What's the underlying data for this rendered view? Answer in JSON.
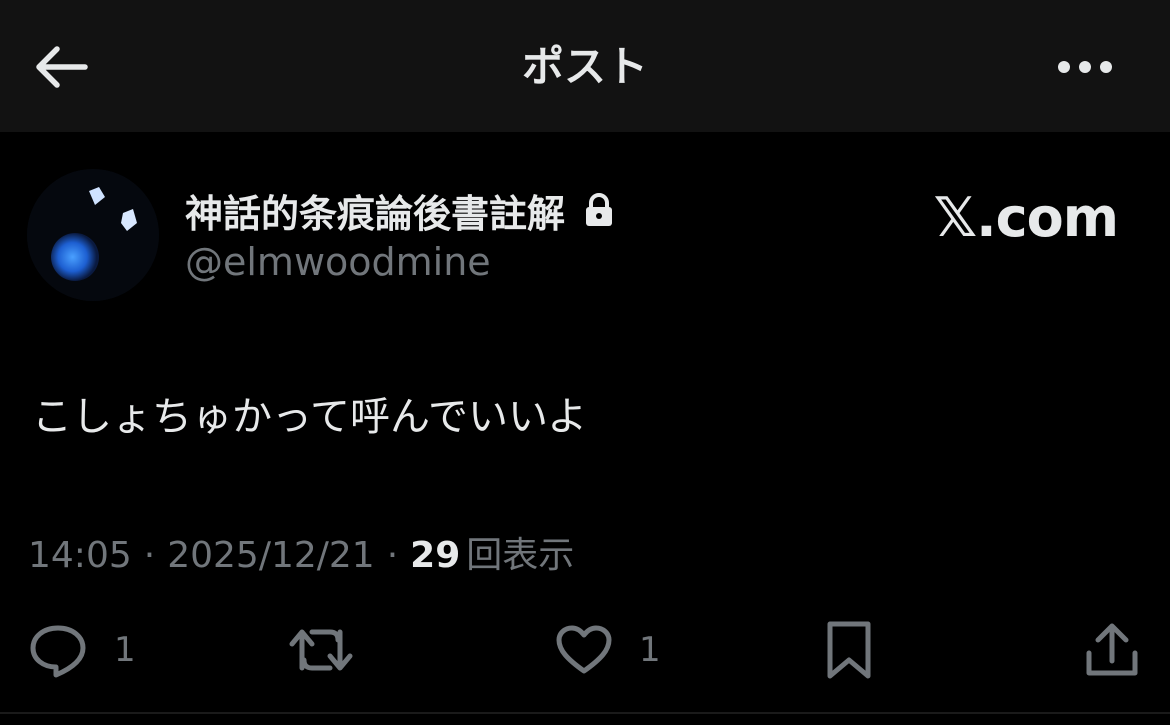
{
  "header": {
    "title": "ポスト",
    "back_icon": "arrow-left-icon",
    "more_icon": "more-horizontal-icon"
  },
  "author": {
    "display_name": "神話的条痕論後書註解",
    "handle": "@elmwoodmine",
    "protected_icon": "lock-icon"
  },
  "brand": {
    "label": "𝕏.com"
  },
  "post": {
    "text": "こしょちゅかって呼んでいいよ"
  },
  "meta": {
    "time": "14:05",
    "separator": "·",
    "date": "2025/12/21",
    "views_count": "29",
    "views_label": "回表示"
  },
  "actions": {
    "reply": {
      "icon": "reply-icon",
      "count": "1"
    },
    "repost": {
      "icon": "repost-icon",
      "count": ""
    },
    "like": {
      "icon": "heart-icon",
      "count": "1"
    },
    "bookmark": {
      "icon": "bookmark-icon"
    },
    "share": {
      "icon": "share-icon"
    }
  },
  "colors": {
    "background": "#000000",
    "header_bg": "#121212",
    "text": "#e7e9ea",
    "muted": "#71767b"
  }
}
